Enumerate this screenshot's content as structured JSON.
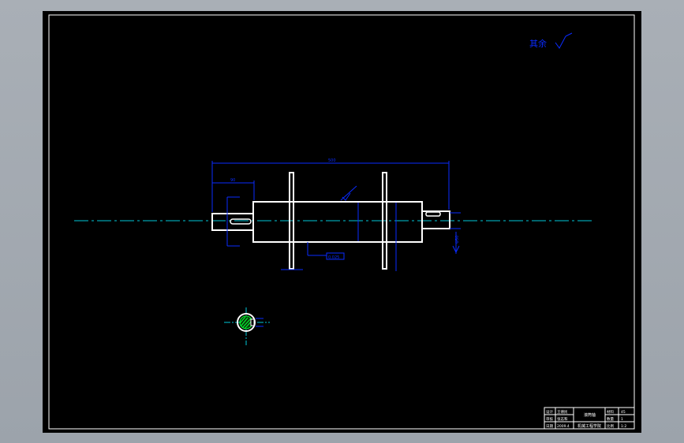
{
  "drawing": {
    "note_text": "其余",
    "roughness_value": "3.2",
    "overall_dimension": "500",
    "left_dimension": "90",
    "mid_tolerance_label": "0.025",
    "keyway_label": "12",
    "diameter_label": "Φ50",
    "small_note": "1:1",
    "datum_label": "A"
  },
  "title_block": {
    "cells": {
      "r1c1": "设计",
      "r1c2": "王德民",
      "r2c1": "审核",
      "r2c2": "张志和",
      "r3c1": "日期",
      "r3c2": "2009.4",
      "part_name": "滚筒轴",
      "school": "机械工程学院",
      "mat_label": "材料",
      "mat_value": "45",
      "qty_label": "数量",
      "qty_value": "1",
      "scale_label": "比例",
      "scale_value": "1:2"
    }
  },
  "colors": {
    "background": "#a9afb6",
    "sheet": "#000000",
    "outline": "#ffffff",
    "dimension": "#0a2bff",
    "centerline": "#00c8d8",
    "hatch": "#00ff33"
  }
}
